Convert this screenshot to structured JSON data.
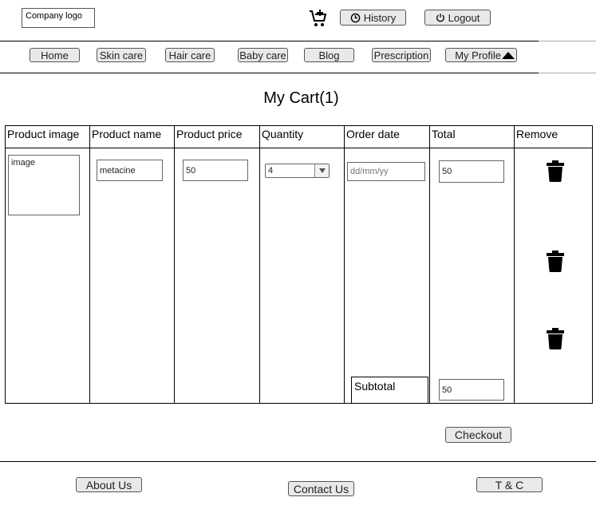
{
  "header": {
    "logo_text": "Company logo",
    "history_label": "History",
    "logout_label": "Logout"
  },
  "nav": {
    "items": [
      "Home",
      "Skin care",
      "Hair care",
      "Baby care",
      "Blog",
      "Prescription",
      "My Profile"
    ]
  },
  "page_title": "My Cart(1)",
  "table": {
    "headers": [
      "Product image",
      "Product name",
      "Product price",
      "Quantity",
      "Order date",
      "Total",
      "Remove"
    ],
    "row": {
      "image_placeholder": "image",
      "product_name": "metacine",
      "product_price": "50",
      "quantity": "4",
      "order_date_placeholder": "dd/mm/yy",
      "total": "50"
    },
    "subtotal_label": "Subtotal",
    "subtotal_value": "50"
  },
  "checkout_label": "Checkout",
  "footer": {
    "about_label": "About Us",
    "contact_label": "Contact Us",
    "tc_label": "T & C"
  },
  "icons": {
    "cart": "cart-add-icon",
    "history": "clock-icon",
    "logout": "power-icon",
    "profile_caret": "triangle-up-icon",
    "dropdown": "triangle-down-icon",
    "delete": "trash-icon"
  }
}
